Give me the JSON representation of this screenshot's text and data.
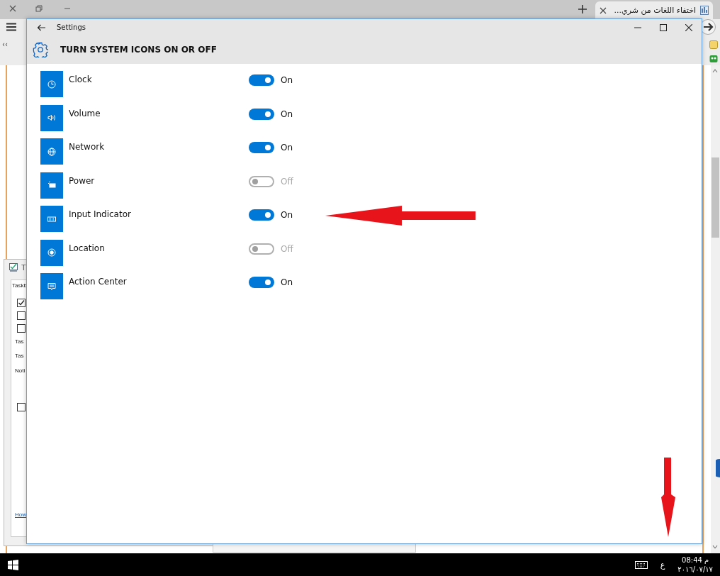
{
  "browser": {
    "tab_title": "اختفاء اللغات من شري...",
    "collapse_glyph": "‹‹"
  },
  "background_dialog": {
    "title": "T",
    "tab": "Taskb",
    "checkboxes": [
      {
        "checked": true
      },
      {
        "checked": false
      },
      {
        "checked": false
      },
      {
        "checked": false
      }
    ],
    "labels": [
      "Tas",
      "Tas",
      "Noti"
    ],
    "link": "How"
  },
  "window": {
    "title": "Settings"
  },
  "page": {
    "heading": "TURN SYSTEM ICONS ON OR OFF"
  },
  "items": [
    {
      "label": "Clock",
      "kind": "clock",
      "on": true,
      "state": "On"
    },
    {
      "label": "Volume",
      "kind": "volume",
      "on": true,
      "state": "On"
    },
    {
      "label": "Network",
      "kind": "network",
      "on": true,
      "state": "On"
    },
    {
      "label": "Power",
      "kind": "power",
      "on": false,
      "state": "Off"
    },
    {
      "label": "Input Indicator",
      "kind": "keyboard",
      "on": true,
      "state": "On"
    },
    {
      "label": "Location",
      "kind": "location",
      "on": false,
      "state": "Off"
    },
    {
      "label": "Action Center",
      "kind": "action",
      "on": true,
      "state": "On"
    }
  ],
  "taskbar": {
    "language": "ع",
    "time": "08:44",
    "ampm": "م",
    "date": "٢٠١٦/٠٧/١٧"
  }
}
